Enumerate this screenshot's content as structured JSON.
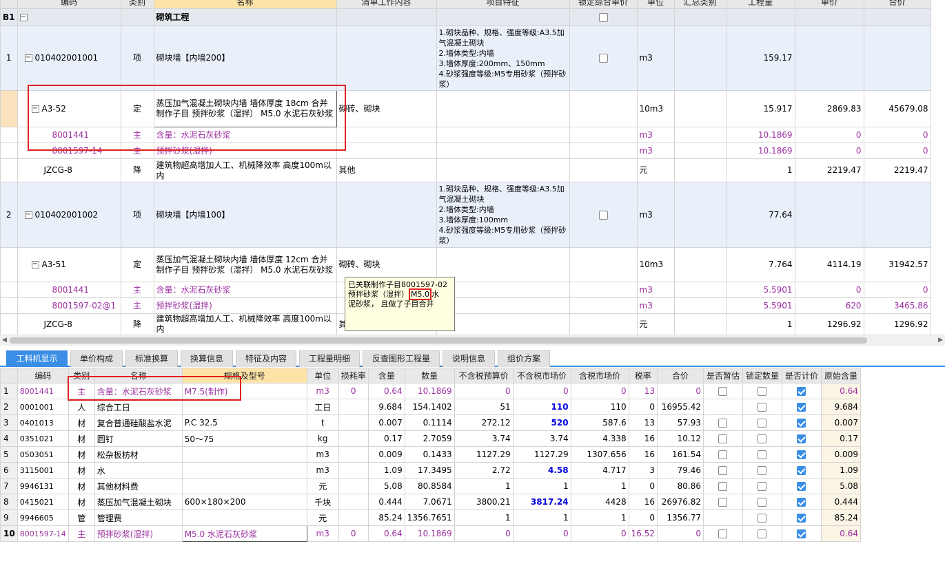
{
  "top_headers": [
    "编码",
    "类别",
    "名称",
    "清单工作内容",
    "项目特征",
    "锁定综合单价",
    "单位",
    "汇总类别",
    "工程量",
    "单价",
    "合价"
  ],
  "rows": [
    {
      "no": "B1",
      "code": "",
      "type": "",
      "name": "砌筑工程",
      "work": "",
      "feature": "",
      "unit": "",
      "qty": "",
      "price": "",
      "total": ""
    },
    {
      "no": "1",
      "code": "010402001001",
      "type": "项",
      "name": "砌块墙【内墙200】",
      "work": "",
      "feature": "1.砌块品种、规格、强度等级:A3.5加气混凝土砌块\n2.墙体类型:内墙\n3.墙体厚度:200mm、150mm\n4.砂浆强度等级:M5专用砂浆（预拌砂浆）",
      "unit": "m3",
      "qty": "159.17",
      "price": "",
      "total": ""
    },
    {
      "no": "",
      "code": "A3-52",
      "type": "定",
      "name": "蒸压加气混凝土砌块内墙 墙体厚度 18cm 合并制作子目 预拌砂浆（湿拌） M5.0 水泥石灰砂浆",
      "work": "砌砖、砌块",
      "feature": "",
      "unit": "10m3",
      "qty": "15.917",
      "price": "2869.83",
      "total": "45679.08"
    },
    {
      "no": "",
      "code": "8001441",
      "type": "主",
      "name": "含量：水泥石灰砂浆",
      "work": "",
      "feature": "",
      "unit": "m3",
      "qty": "10.1869",
      "price": "0",
      "total": "0"
    },
    {
      "no": "",
      "code": "8001597-14",
      "type": "主",
      "name": "预拌砂浆(湿拌)",
      "work": "",
      "feature": "",
      "unit": "m3",
      "qty": "10.1869",
      "price": "0",
      "total": "0"
    },
    {
      "no": "",
      "code": "JZCG-8",
      "type": "降",
      "name": "建筑物超高增加人工、机械降效率 高度100m以内",
      "work": "其他",
      "feature": "",
      "unit": "元",
      "qty": "1",
      "price": "2219.47",
      "total": "2219.47"
    },
    {
      "no": "2",
      "code": "010402001002",
      "type": "项",
      "name": "砌块墙【内墙100】",
      "work": "",
      "feature": "1.砌块品种、规格、强度等级:A3.5加气混凝土砌块\n2.墙体类型:内墙\n3.墙体厚度:100mm\n4.砂浆强度等级:M5专用砂浆（预拌砂浆）",
      "unit": "m3",
      "qty": "77.64",
      "price": "",
      "total": ""
    },
    {
      "no": "",
      "code": "A3-51",
      "type": "定",
      "name": "蒸压加气混凝土砌块内墙 墙体厚度 12cm 合并制作子目 预拌砂浆（湿拌） M5.0 水泥石灰砂浆",
      "work": "砌砖、砌块",
      "feature": "",
      "unit": "10m3",
      "qty": "7.764",
      "price": "4114.19",
      "total": "31942.57"
    },
    {
      "no": "",
      "code": "8001441",
      "type": "主",
      "name": "含量：水泥石灰砂浆",
      "work": "",
      "feature": "",
      "unit": "m3",
      "qty": "5.5901",
      "price": "0",
      "total": "0"
    },
    {
      "no": "",
      "code": "8001597-02@1",
      "type": "主",
      "name": "预拌砂浆(湿拌)",
      "work": "",
      "feature": "",
      "unit": "m3",
      "qty": "5.5901",
      "price": "620",
      "total": "3465.86"
    },
    {
      "no": "",
      "code": "JZCG-8",
      "type": "降",
      "name": "建筑物超高增加人工、机械降效率 高度100m以内",
      "work": "其",
      "feature": "",
      "unit": "元",
      "qty": "1",
      "price": "1296.92",
      "total": "1296.92"
    }
  ],
  "tooltip": {
    "l1": "已关联制作子目8001597-02",
    "l2a": "预拌砂浆（湿拌）",
    "l2b": "M5.0",
    "l2c": "水",
    "l3": "泥砂浆， 且做了子目合并"
  },
  "tabs": [
    "工料机显示",
    "单价构成",
    "标准换算",
    "换算信息",
    "特征及内容",
    "工程量明细",
    "反查图形工程量",
    "说明信息",
    "组价方案"
  ],
  "bottom_headers": [
    "编码",
    "类别",
    "名称",
    "规格及型号",
    "单位",
    "损耗率",
    "含量",
    "数量",
    "不含税预算价",
    "不含税市场价",
    "含税市场价",
    "税率",
    "合价",
    "是否暂估",
    "锁定数量",
    "是否计价",
    "原始含量"
  ],
  "bottom_rows": [
    {
      "no": "1",
      "code": "8001441",
      "type": "主",
      "name": "含量：水泥石灰砂浆",
      "spec": "M7.5(制作)",
      "unit": "m3",
      "loss": "0",
      "content": "0.64",
      "qty": "10.1869",
      "p1": "0",
      "p2": "0",
      "p3": "0",
      "tax": "13",
      "total": "0",
      "orig": "0.64"
    },
    {
      "no": "2",
      "code": "0001001",
      "type": "人",
      "name": "综合工日",
      "spec": "",
      "unit": "工日",
      "loss": "",
      "content": "9.684",
      "qty": "154.1402",
      "p1": "51",
      "p2": "110",
      "p3": "110",
      "tax": "0",
      "total": "16955.42",
      "orig": "9.684"
    },
    {
      "no": "3",
      "code": "0401013",
      "type": "材",
      "name": "复合普通硅酸盐水泥",
      "spec": "P.C 32.5",
      "unit": "t",
      "loss": "",
      "content": "0.007",
      "qty": "0.1114",
      "p1": "272.12",
      "p2": "520",
      "p3": "587.6",
      "tax": "13",
      "total": "57.93",
      "orig": "0.007"
    },
    {
      "no": "4",
      "code": "0351021",
      "type": "材",
      "name": "圆钉",
      "spec": "50～75",
      "unit": "kg",
      "loss": "",
      "content": "0.17",
      "qty": "2.7059",
      "p1": "3.74",
      "p2": "3.74",
      "p3": "4.338",
      "tax": "16",
      "total": "10.12",
      "orig": "0.17"
    },
    {
      "no": "5",
      "code": "0503051",
      "type": "材",
      "name": "松杂板枋材",
      "spec": "",
      "unit": "m3",
      "loss": "",
      "content": "0.009",
      "qty": "0.1433",
      "p1": "1127.29",
      "p2": "1127.29",
      "p3": "1307.656",
      "tax": "16",
      "total": "161.54",
      "orig": "0.009"
    },
    {
      "no": "6",
      "code": "3115001",
      "type": "材",
      "name": "水",
      "spec": "",
      "unit": "m3",
      "loss": "",
      "content": "1.09",
      "qty": "17.3495",
      "p1": "2.72",
      "p2": "4.58",
      "p3": "4.717",
      "tax": "3",
      "total": "79.46",
      "orig": "1.09"
    },
    {
      "no": "7",
      "code": "9946131",
      "type": "材",
      "name": "其他材料费",
      "spec": "",
      "unit": "元",
      "loss": "",
      "content": "5.08",
      "qty": "80.8584",
      "p1": "1",
      "p2": "1",
      "p3": "1",
      "tax": "0",
      "total": "80.86",
      "orig": "5.08"
    },
    {
      "no": "8",
      "code": "0415021",
      "type": "材",
      "name": "蒸压加气混凝土砌块",
      "spec": "600×180×200",
      "unit": "千块",
      "loss": "",
      "content": "0.444",
      "qty": "7.0671",
      "p1": "3800.21",
      "p2": "3817.24",
      "p3": "4428",
      "tax": "16",
      "total": "26976.82",
      "orig": "0.444"
    },
    {
      "no": "9",
      "code": "9946605",
      "type": "管",
      "name": "管理费",
      "spec": "",
      "unit": "元",
      "loss": "",
      "content": "85.24",
      "qty": "1356.7651",
      "p1": "1",
      "p2": "1",
      "p3": "1",
      "tax": "0",
      "total": "1356.77",
      "orig": "85.24"
    },
    {
      "no": "10",
      "code": "8001597-14",
      "type": "主",
      "name": "预拌砂浆(湿拌)",
      "spec": "M5.0 水泥石灰砂浆",
      "unit": "m3",
      "loss": "0",
      "content": "0.64",
      "qty": "10.1869",
      "p1": "0",
      "p2": "0",
      "p3": "0",
      "tax": "16.52",
      "total": "0",
      "orig": "0.64"
    }
  ],
  "colors": {
    "accent": "#3a8ee6",
    "purple": "#9b2fa0",
    "highlight_red": "#e02020",
    "market_price_blue": "#0000e0"
  }
}
